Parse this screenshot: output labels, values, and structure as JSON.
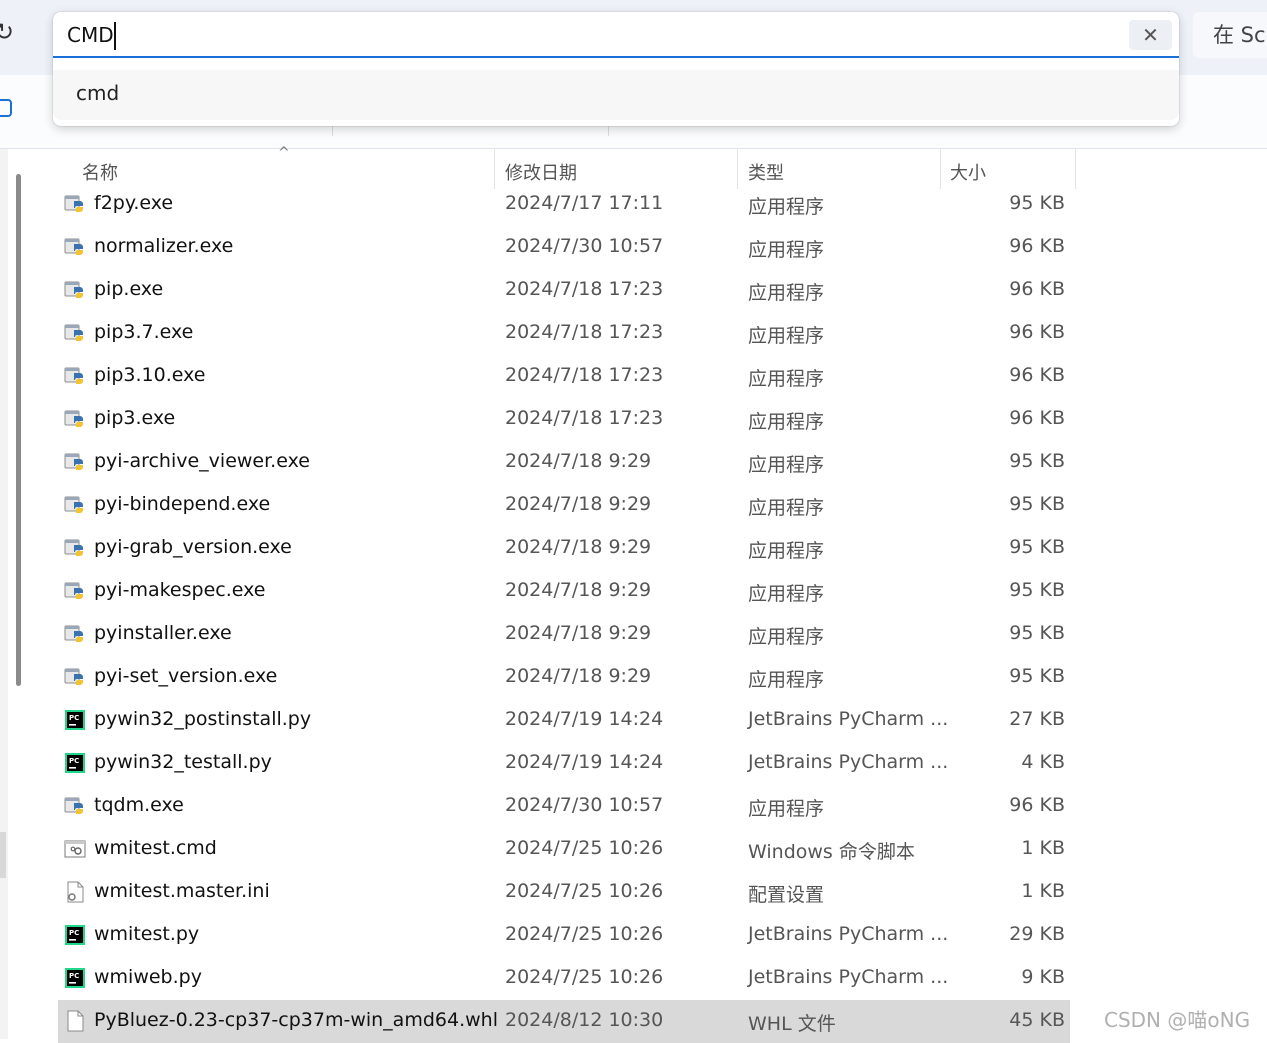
{
  "address_bar": {
    "value": "CMD",
    "clear_icon": "close-icon",
    "suggestion": "cmd"
  },
  "search_scope_label": "在 Scr",
  "columns": {
    "name": "名称",
    "date": "修改日期",
    "type": "类型",
    "size": "大小"
  },
  "files": [
    {
      "name": "f2py.exe",
      "date": "2024/7/17 17:11",
      "type": "应用程序",
      "size": "95 KB",
      "icon": "python-exe-icon"
    },
    {
      "name": "normalizer.exe",
      "date": "2024/7/30 10:57",
      "type": "应用程序",
      "size": "96 KB",
      "icon": "python-exe-icon"
    },
    {
      "name": "pip.exe",
      "date": "2024/7/18 17:23",
      "type": "应用程序",
      "size": "96 KB",
      "icon": "python-exe-icon"
    },
    {
      "name": "pip3.7.exe",
      "date": "2024/7/18 17:23",
      "type": "应用程序",
      "size": "96 KB",
      "icon": "python-exe-icon"
    },
    {
      "name": "pip3.10.exe",
      "date": "2024/7/18 17:23",
      "type": "应用程序",
      "size": "96 KB",
      "icon": "python-exe-icon"
    },
    {
      "name": "pip3.exe",
      "date": "2024/7/18 17:23",
      "type": "应用程序",
      "size": "96 KB",
      "icon": "python-exe-icon"
    },
    {
      "name": "pyi-archive_viewer.exe",
      "date": "2024/7/18 9:29",
      "type": "应用程序",
      "size": "95 KB",
      "icon": "python-exe-icon"
    },
    {
      "name": "pyi-bindepend.exe",
      "date": "2024/7/18 9:29",
      "type": "应用程序",
      "size": "95 KB",
      "icon": "python-exe-icon"
    },
    {
      "name": "pyi-grab_version.exe",
      "date": "2024/7/18 9:29",
      "type": "应用程序",
      "size": "95 KB",
      "icon": "python-exe-icon"
    },
    {
      "name": "pyi-makespec.exe",
      "date": "2024/7/18 9:29",
      "type": "应用程序",
      "size": "95 KB",
      "icon": "python-exe-icon"
    },
    {
      "name": "pyinstaller.exe",
      "date": "2024/7/18 9:29",
      "type": "应用程序",
      "size": "95 KB",
      "icon": "python-exe-icon"
    },
    {
      "name": "pyi-set_version.exe",
      "date": "2024/7/18 9:29",
      "type": "应用程序",
      "size": "95 KB",
      "icon": "python-exe-icon"
    },
    {
      "name": "pywin32_postinstall.py",
      "date": "2024/7/19 14:24",
      "type": "JetBrains PyCharm ...",
      "size": "27 KB",
      "icon": "pycharm-file-icon"
    },
    {
      "name": "pywin32_testall.py",
      "date": "2024/7/19 14:24",
      "type": "JetBrains PyCharm ...",
      "size": "4 KB",
      "icon": "pycharm-file-icon"
    },
    {
      "name": "tqdm.exe",
      "date": "2024/7/30 10:57",
      "type": "应用程序",
      "size": "96 KB",
      "icon": "python-exe-icon"
    },
    {
      "name": "wmitest.cmd",
      "date": "2024/7/25 10:26",
      "type": "Windows 命令脚本",
      "size": "1 KB",
      "icon": "cmd-script-icon"
    },
    {
      "name": "wmitest.master.ini",
      "date": "2024/7/25 10:26",
      "type": "配置设置",
      "size": "1 KB",
      "icon": "config-file-icon"
    },
    {
      "name": "wmitest.py",
      "date": "2024/7/25 10:26",
      "type": "JetBrains PyCharm ...",
      "size": "29 KB",
      "icon": "pycharm-file-icon"
    },
    {
      "name": "wmiweb.py",
      "date": "2024/7/25 10:26",
      "type": "JetBrains PyCharm ...",
      "size": "9 KB",
      "icon": "pycharm-file-icon"
    },
    {
      "name": "PyBluez-0.23-cp37-cp37m-win_amd64.whl",
      "date": "2024/8/12 10:30",
      "type": "WHL 文件",
      "size": "45 KB",
      "icon": "blank-file-icon",
      "selected": true
    }
  ],
  "watermark": "CSDN @喵oNG"
}
